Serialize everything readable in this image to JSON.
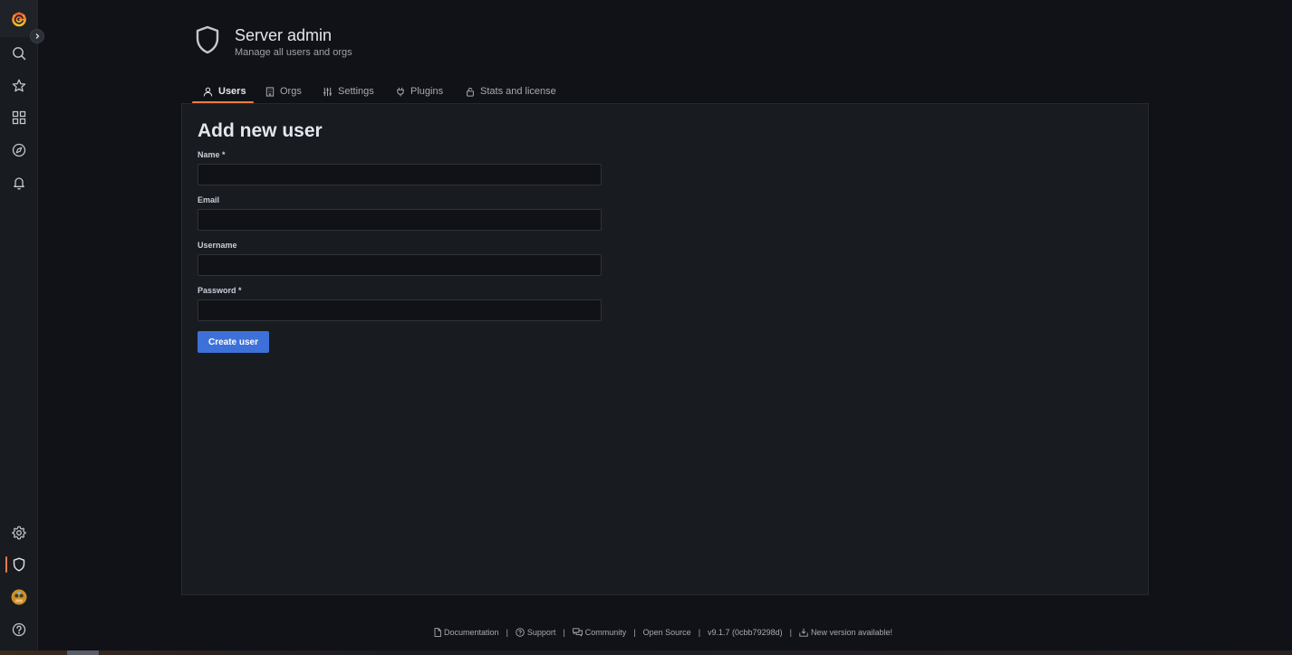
{
  "sidebar": {
    "logo_icon": "grafana-logo-icon",
    "expand_icon": "chevron-right-icon",
    "top_items": [
      {
        "name": "search",
        "icon": "search-icon"
      },
      {
        "name": "starred",
        "icon": "star-icon"
      },
      {
        "name": "dashboards",
        "icon": "apps-icon"
      },
      {
        "name": "explore",
        "icon": "compass-icon"
      },
      {
        "name": "alerting",
        "icon": "bell-icon"
      }
    ],
    "bottom_items": [
      {
        "name": "configuration",
        "icon": "gear-icon"
      },
      {
        "name": "server-admin",
        "icon": "shield-icon",
        "active": true
      },
      {
        "name": "profile",
        "icon": "avatar"
      },
      {
        "name": "help",
        "icon": "question-circle-icon"
      }
    ],
    "accent_color": "#ff7941"
  },
  "header": {
    "title": "Server admin",
    "subtitle": "Manage all users and orgs",
    "icon": "shield-icon"
  },
  "tabs": [
    {
      "label": "Users",
      "icon": "user-icon",
      "active": true
    },
    {
      "label": "Orgs",
      "icon": "building-icon"
    },
    {
      "label": "Settings",
      "icon": "sliders-icon"
    },
    {
      "label": "Plugins",
      "icon": "plug-icon"
    },
    {
      "label": "Stats and license",
      "icon": "lock-icon"
    }
  ],
  "form": {
    "title": "Add new user",
    "fields": [
      {
        "label": "Name *",
        "value": "",
        "type": "text"
      },
      {
        "label": "Email",
        "value": "",
        "type": "text"
      },
      {
        "label": "Username",
        "value": "",
        "type": "text"
      },
      {
        "label": "Password *",
        "value": "",
        "type": "password"
      }
    ],
    "submit_label": "Create user",
    "button_color": "#3d71d9"
  },
  "footer": {
    "documentation": "Documentation",
    "support": "Support",
    "community": "Community",
    "open_source": "Open Source",
    "version": "v9.1.7 (0cbb79298d)",
    "new_version": "New version available!",
    "separator": "|"
  }
}
